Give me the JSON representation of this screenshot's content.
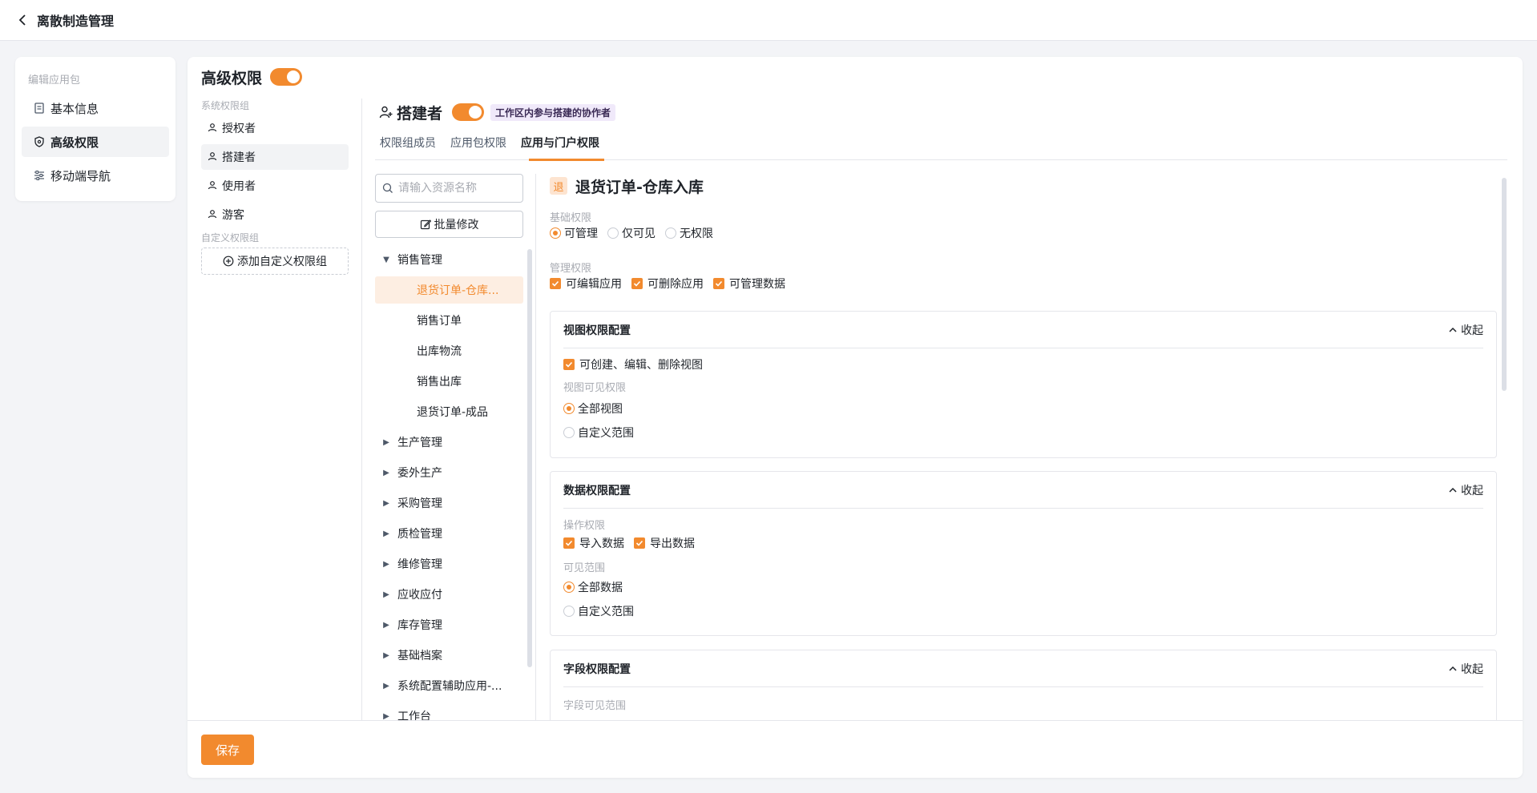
{
  "header": {
    "title": "离散制造管理",
    "back_icon": "chevron-left-icon"
  },
  "leftnav": {
    "group_title": "编辑应用包",
    "items": [
      {
        "label": "基本信息",
        "icon": "document-icon",
        "active": false
      },
      {
        "label": "高级权限",
        "icon": "shield-icon",
        "active": true
      },
      {
        "label": "移动端导航",
        "icon": "sliders-icon",
        "active": false
      }
    ]
  },
  "main": {
    "title": "高级权限",
    "toggle_on": true
  },
  "groups": {
    "system_label": "系统权限组",
    "items": [
      {
        "label": "授权者",
        "active": false
      },
      {
        "label": "搭建者",
        "active": true
      },
      {
        "label": "使用者",
        "active": false
      },
      {
        "label": "游客",
        "active": false
      }
    ],
    "custom_label": "自定义权限组",
    "add_label": "添加自定义权限组"
  },
  "role": {
    "name": "搭建者",
    "toggle_on": true,
    "tag": "工作区内参与搭建的协作者"
  },
  "tabs": [
    {
      "label": "权限组成员",
      "active": false
    },
    {
      "label": "应用包权限",
      "active": false
    },
    {
      "label": "应用与门户权限",
      "active": true
    }
  ],
  "tree": {
    "search_placeholder": "请输入资源名称",
    "batch_label": "批量修改",
    "groups": [
      {
        "label": "销售管理",
        "expanded": true,
        "children": [
          {
            "label": "退货订单-仓库...",
            "active": true
          },
          {
            "label": "销售订单",
            "active": false
          },
          {
            "label": "出库物流",
            "active": false
          },
          {
            "label": "销售出库",
            "active": false
          },
          {
            "label": "退货订单-成品",
            "active": false
          }
        ]
      },
      {
        "label": "生产管理",
        "expanded": false
      },
      {
        "label": "委外生产",
        "expanded": false
      },
      {
        "label": "采购管理",
        "expanded": false
      },
      {
        "label": "质检管理",
        "expanded": false
      },
      {
        "label": "维修管理",
        "expanded": false
      },
      {
        "label": "应收应付",
        "expanded": false
      },
      {
        "label": "库存管理",
        "expanded": false
      },
      {
        "label": "基础档案",
        "expanded": false
      },
      {
        "label": "系统配置辅助应用-...",
        "expanded": false
      },
      {
        "label": "工作台",
        "expanded": false
      }
    ]
  },
  "detail": {
    "badge": "退",
    "title": "退货订单-仓库入库",
    "basic_label": "基础权限",
    "basic_options": [
      {
        "label": "可管理",
        "selected": true
      },
      {
        "label": "仅可见",
        "selected": false
      },
      {
        "label": "无权限",
        "selected": false
      }
    ],
    "manage_label": "管理权限",
    "manage_options": [
      {
        "label": "可编辑应用",
        "checked": true
      },
      {
        "label": "可删除应用",
        "checked": true
      },
      {
        "label": "可管理数据",
        "checked": true
      }
    ],
    "collapse_label": "收起",
    "view_card": {
      "title": "视图权限配置",
      "check_label": "可创建、编辑、删除视图",
      "visible_label": "视图可见权限",
      "opt_all": "全部视图",
      "opt_custom": "自定义范围"
    },
    "data_card": {
      "title": "数据权限配置",
      "op_label": "操作权限",
      "import_label": "导入数据",
      "export_label": "导出数据",
      "scope_label": "可见范围",
      "opt_all": "全部数据",
      "opt_custom": "自定义范围"
    },
    "field_card": {
      "title": "字段权限配置",
      "scope_label": "字段可见范围"
    }
  },
  "footer": {
    "save_label": "保存"
  },
  "colors": {
    "accent": "#f28a2e",
    "tag_bg": "#f0e9fa"
  }
}
